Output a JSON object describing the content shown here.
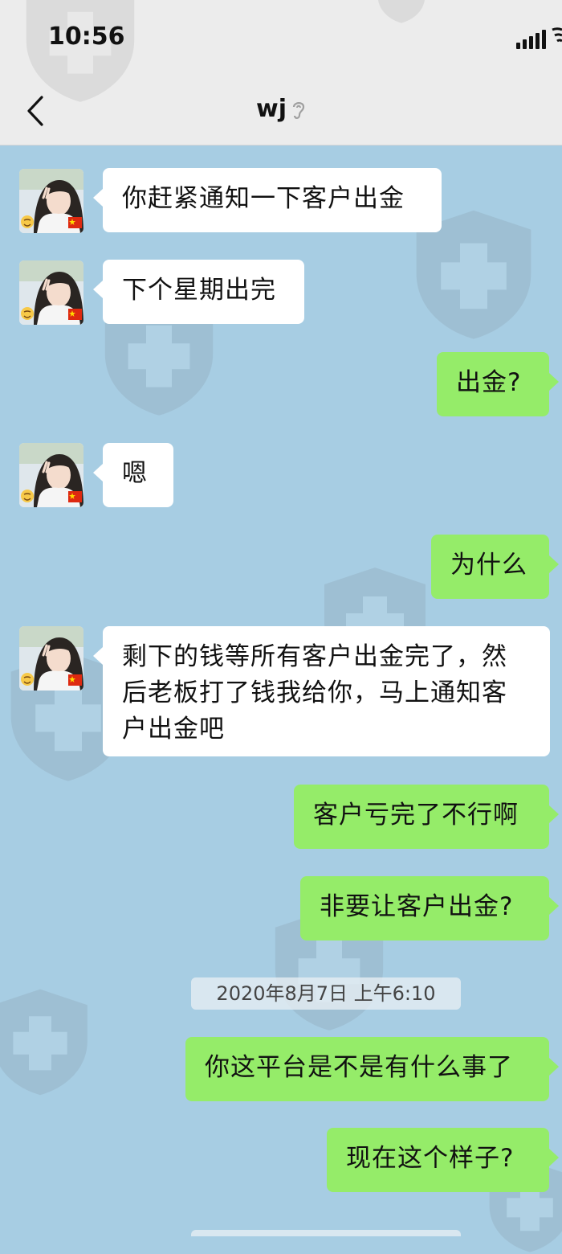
{
  "status_bar": {
    "time": "10:56"
  },
  "nav": {
    "title": "wj",
    "back_icon": "chevron-left-icon",
    "mode_icon": "ear-icon"
  },
  "colors": {
    "chat_bg": "#a7cde3",
    "sent_bubble": "#95ec69",
    "received_bubble": "#ffffff"
  },
  "messages": [
    {
      "from": "contact",
      "text": "你赶紧通知一下客户出金"
    },
    {
      "from": "contact",
      "text": "下个星期出完"
    },
    {
      "from": "me",
      "text": "出金?"
    },
    {
      "from": "contact",
      "text": "嗯"
    },
    {
      "from": "me",
      "text": "为什么"
    },
    {
      "from": "contact",
      "text": "剩下的钱等所有客户出金完了，然后老板打了钱我给你，马上通知客户出金吧"
    },
    {
      "from": "me",
      "text": "客户亏完了不行啊"
    },
    {
      "from": "me",
      "text": "非要让客户出金?"
    },
    {
      "from": "me",
      "text": "你这平台是不是有什么事了"
    },
    {
      "from": "me",
      "text": "现在这个样子?"
    }
  ],
  "timestamp": "2020年8月7日 上午6:10"
}
